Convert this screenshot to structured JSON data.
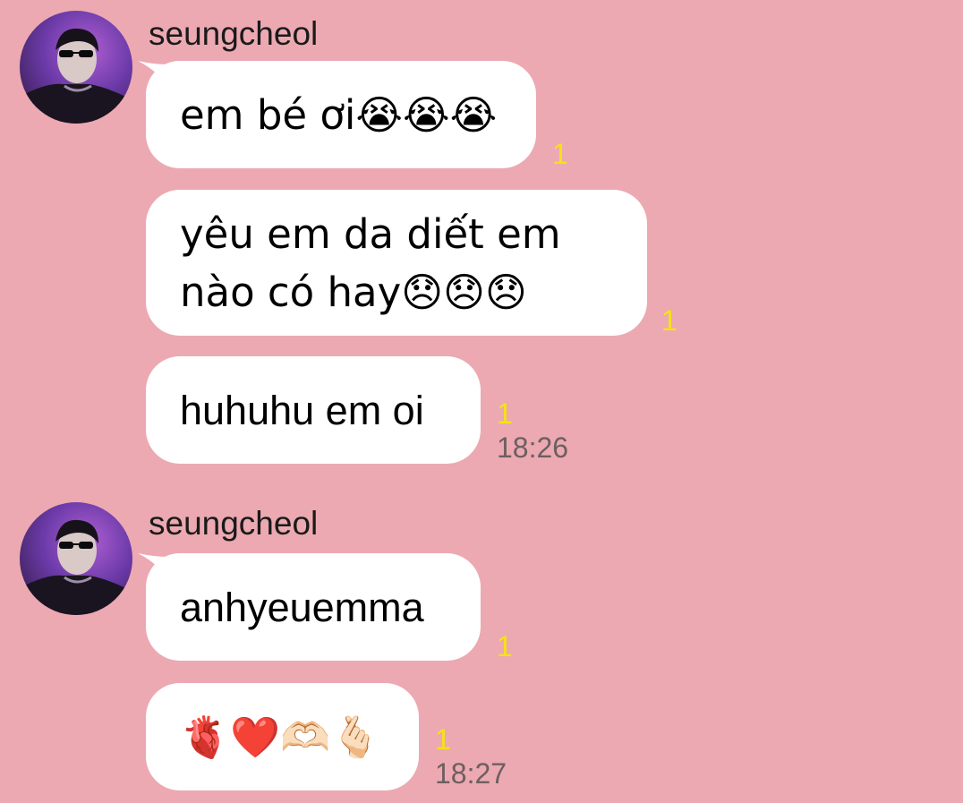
{
  "colors": {
    "background": "#ECA9B2",
    "bubble": "#ffffff",
    "unread": "#F5E216",
    "time": "#6e5e60"
  },
  "groups": [
    {
      "sender": "seungcheol",
      "avatar_icon": "profile-photo",
      "messages": [
        {
          "text": "em bé ơi😭😭😭",
          "unread": "1"
        },
        {
          "text": "yêu em da diết em\nnào có hay😞😞😞",
          "unread": "1"
        },
        {
          "text": "huhuhu em oi",
          "unread": "1",
          "time": "18:26"
        }
      ]
    },
    {
      "sender": "seungcheol",
      "avatar_icon": "profile-photo",
      "messages": [
        {
          "text": "anhyeuemma",
          "unread": "1"
        },
        {
          "text": "🫀❤️🫶🏻🫰🏻",
          "unread": "1",
          "time": "18:27"
        }
      ]
    }
  ]
}
